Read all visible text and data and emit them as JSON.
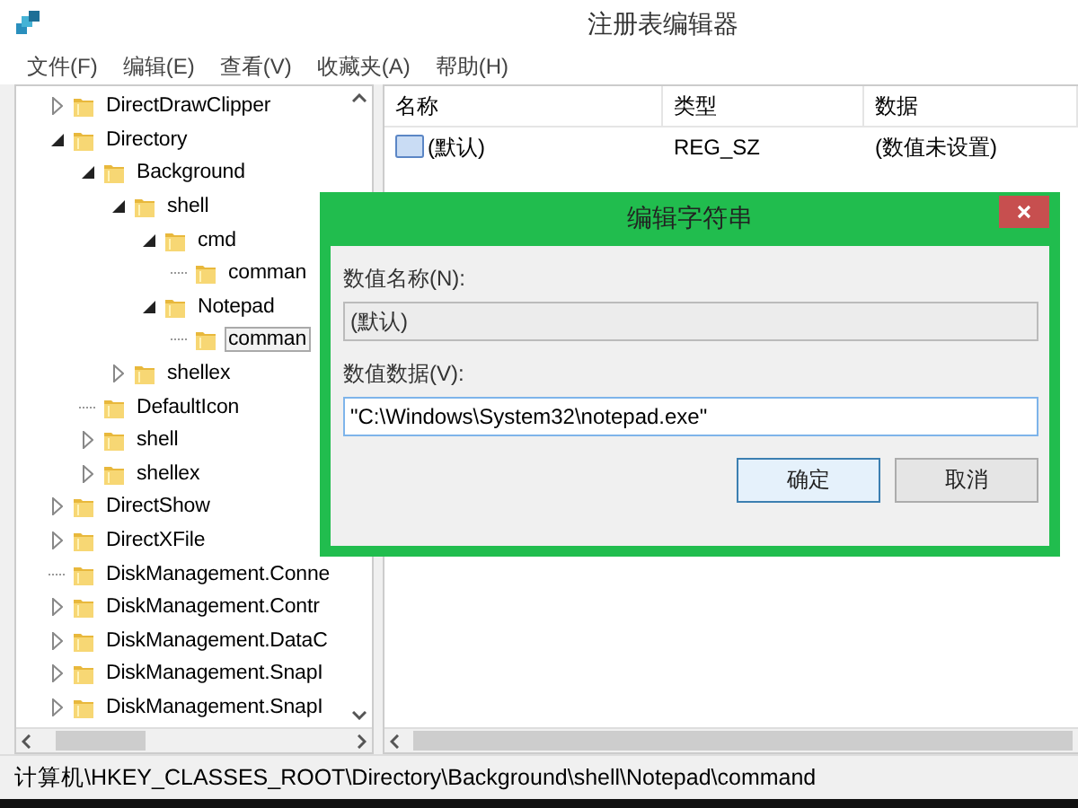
{
  "window": {
    "title": "注册表编辑器"
  },
  "menu": [
    "文件(F)",
    "编辑(E)",
    "查看(V)",
    "收藏夹(A)",
    "帮助(H)"
  ],
  "tree": {
    "items": [
      {
        "label": "DirectDrawClipper",
        "kind": "branch",
        "expanded": false,
        "selected": false
      },
      {
        "label": "Directory",
        "kind": "branch",
        "expanded": true,
        "selected": false,
        "children": [
          {
            "label": "Background",
            "kind": "branch",
            "expanded": true,
            "selected": false,
            "children": [
              {
                "label": "shell",
                "kind": "branch",
                "expanded": true,
                "selected": false,
                "children": [
                  {
                    "label": "cmd",
                    "kind": "branch",
                    "expanded": true,
                    "selected": false,
                    "children": [
                      {
                        "label": "comman",
                        "kind": "leaf",
                        "selected": false
                      }
                    ]
                  },
                  {
                    "label": "Notepad",
                    "kind": "branch",
                    "expanded": true,
                    "selected": false,
                    "children": [
                      {
                        "label": "comman",
                        "kind": "leaf",
                        "selected": true
                      }
                    ]
                  }
                ]
              },
              {
                "label": "shellex",
                "kind": "branch",
                "expanded": false,
                "selected": false
              }
            ]
          },
          {
            "label": "DefaultIcon",
            "kind": "leaf",
            "selected": false
          },
          {
            "label": "shell",
            "kind": "branch",
            "expanded": false,
            "selected": false
          },
          {
            "label": "shellex",
            "kind": "branch",
            "expanded": false,
            "selected": false
          }
        ]
      },
      {
        "label": "DirectShow",
        "kind": "branch",
        "expanded": false,
        "selected": false
      },
      {
        "label": "DirectXFile",
        "kind": "branch",
        "expanded": false,
        "selected": false
      },
      {
        "label": "DiskManagement.Conne",
        "kind": "leaf",
        "selected": false
      },
      {
        "label": "DiskManagement.Contr",
        "kind": "branch",
        "expanded": false,
        "selected": false
      },
      {
        "label": "DiskManagement.DataC",
        "kind": "branch",
        "expanded": false,
        "selected": false
      },
      {
        "label": "DiskManagement.SnapI",
        "kind": "branch",
        "expanded": false,
        "selected": false
      },
      {
        "label": "DiskManagement.SnapI",
        "kind": "branch",
        "expanded": false,
        "selected": false
      }
    ]
  },
  "list": {
    "columns": [
      "名称",
      "类型",
      "数据"
    ],
    "rows": [
      {
        "name": "(默认)",
        "type": "REG_SZ",
        "data": "(数值未设置)"
      }
    ]
  },
  "dialog": {
    "title": "编辑字符串",
    "name_label": "数值名称(N):",
    "name_value": "(默认)",
    "data_label": "数值数据(V):",
    "data_value": "\"C:\\Windows\\System32\\notepad.exe\"",
    "buttons": [
      {
        "label": "确定",
        "default": true
      },
      {
        "label": "取消",
        "default": false
      }
    ]
  },
  "status_bar": "计算机\\HKEY_CLASSES_ROOT\\Directory\\Background\\shell\\Notepad\\command"
}
